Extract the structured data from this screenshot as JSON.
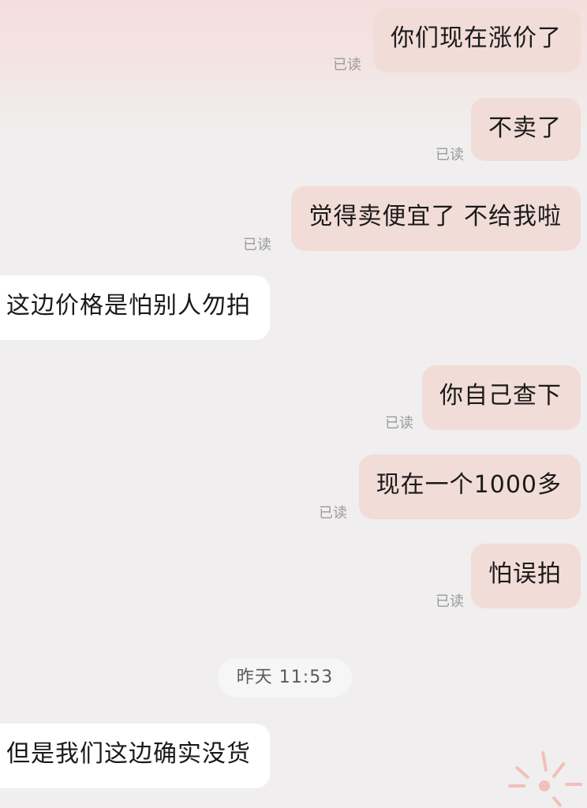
{
  "chat": {
    "messages": [
      {
        "direction": "out",
        "text": "你们现在涨价了",
        "status": "已读"
      },
      {
        "direction": "out",
        "text": "不卖了",
        "status": "已读"
      },
      {
        "direction": "out",
        "text": "觉得卖便宜了  不给我啦",
        "status": "已读"
      },
      {
        "direction": "in",
        "text": "这边价格是怕别人勿拍"
      },
      {
        "direction": "out",
        "text": "你自己查下",
        "status": "已读"
      },
      {
        "direction": "out",
        "text": "现在一个1000多",
        "status": "已读"
      },
      {
        "direction": "out",
        "text": "怕误拍",
        "status": "已读"
      },
      {
        "direction": "in",
        "text": "但是我们这边确实没货"
      }
    ],
    "timestamp": "昨天 11:53"
  },
  "colors": {
    "outgoing_bubble": "#f1dcd7",
    "incoming_bubble": "#ffffff",
    "background": "#f0eeee",
    "read_receipt": "#9b9b9b",
    "decor_accent": "#f2b8b2"
  },
  "icons": {
    "corner_decoration": "firework-sparkle-icon"
  }
}
